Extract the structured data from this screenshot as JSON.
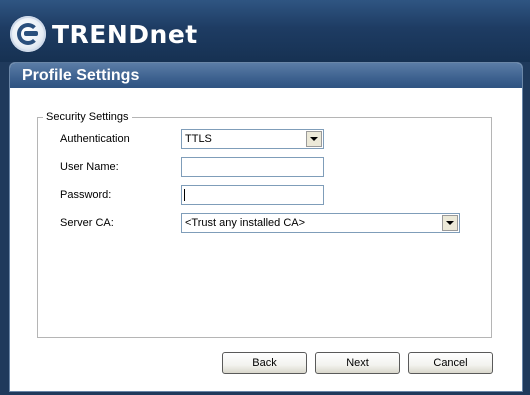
{
  "brand": {
    "logo_text": "TRENDnet"
  },
  "panel": {
    "title": "Profile Settings"
  },
  "group": {
    "legend": "Security Settings"
  },
  "form": {
    "authentication": {
      "label": "Authentication",
      "value": "TTLS"
    },
    "username": {
      "label": "User Name:",
      "value": ""
    },
    "password": {
      "label": "Password:",
      "value": ""
    },
    "server_ca": {
      "label": "Server CA:",
      "value": "<Trust any installed CA>"
    }
  },
  "buttons": {
    "back": "Back",
    "next": "Next",
    "cancel": "Cancel"
  }
}
